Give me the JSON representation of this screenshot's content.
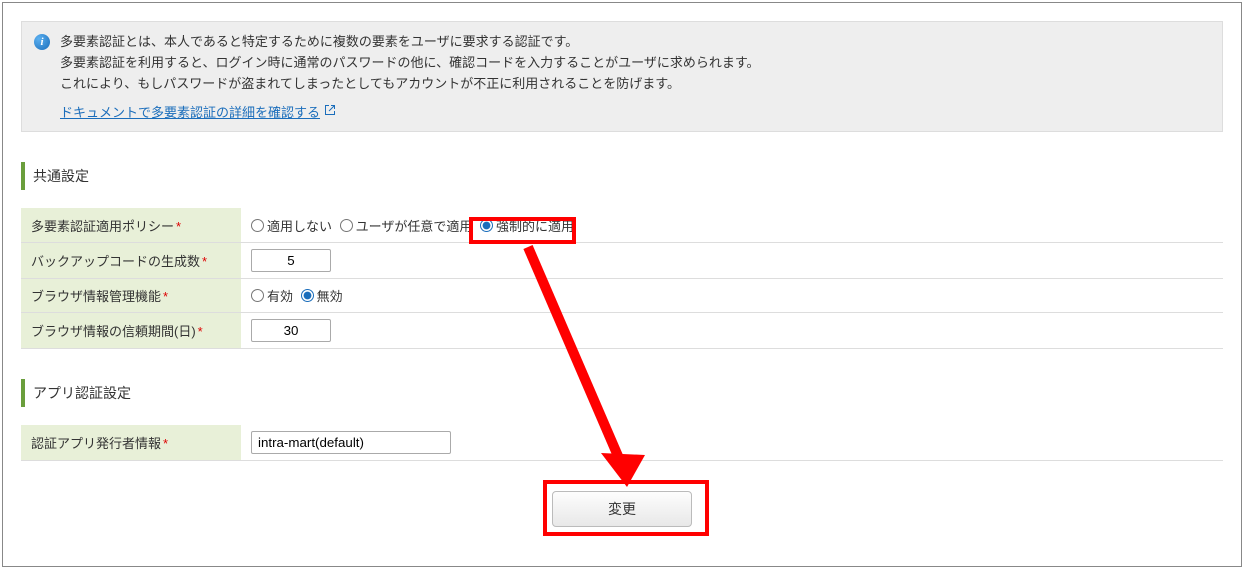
{
  "info": {
    "line1": "多要素認証とは、本人であると特定するために複数の要素をユーザに要求する認証です。",
    "line2": "多要素認証を利用すると、ログイン時に通常のパスワードの他に、確認コードを入力することがユーザに求められます。",
    "line3": "これにより、もしパスワードが盗まれてしまったとしてもアカウントが不正に利用されることを防げます。",
    "link": "ドキュメントで多要素認証の詳細を確認する"
  },
  "sections": {
    "common": "共通設定",
    "app": "アプリ認証設定"
  },
  "fields": {
    "policy": {
      "label": "多要素認証適用ポリシー",
      "options": [
        "適用しない",
        "ユーザが任意で適用",
        "強制的に適用"
      ],
      "selected": 2
    },
    "backupCount": {
      "label": "バックアップコードの生成数",
      "value": "5"
    },
    "browserInfo": {
      "label": "ブラウザ情報管理機能",
      "options": [
        "有効",
        "無効"
      ],
      "selected": 1
    },
    "trustDays": {
      "label": "ブラウザ情報の信頼期間(日)",
      "value": "30"
    },
    "issuer": {
      "label": "認証アプリ発行者情報",
      "value": "intra-mart(default)"
    }
  },
  "buttons": {
    "submit": "変更"
  }
}
